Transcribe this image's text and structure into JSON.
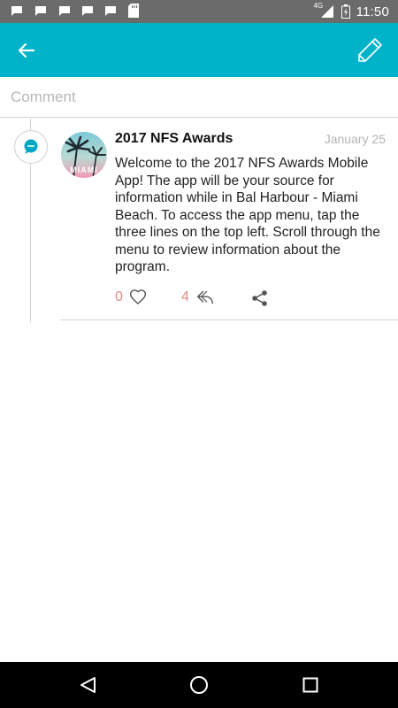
{
  "status_bar": {
    "time": "11:50",
    "network": "4G",
    "notification_icons": [
      "message-icon",
      "message-icon",
      "message-icon",
      "message-icon",
      "message-icon",
      "sd-card-icon"
    ]
  },
  "app_bar": {
    "color": "#00b3c9",
    "back_icon": "arrow-back-icon",
    "edit_icon": "pencil-icon"
  },
  "comment": {
    "placeholder": "Comment",
    "value": ""
  },
  "post": {
    "title": "2017 NFS Awards",
    "date": "January 25",
    "avatar_text": "MIAMI",
    "body": "Welcome to the 2017 NFS Awards Mobile App! The app will be your source for information while in Bal Harbour - Miami Beach. To access the app menu, tap the three lines on the top left. Scroll through the menu to review information about the program.",
    "likes": "0",
    "replies": "4",
    "accent_color": "#e08a8a"
  },
  "nav_bar": {
    "back_icon": "triangle-back-icon",
    "home_icon": "circle-home-icon",
    "recents_icon": "square-recents-icon"
  }
}
